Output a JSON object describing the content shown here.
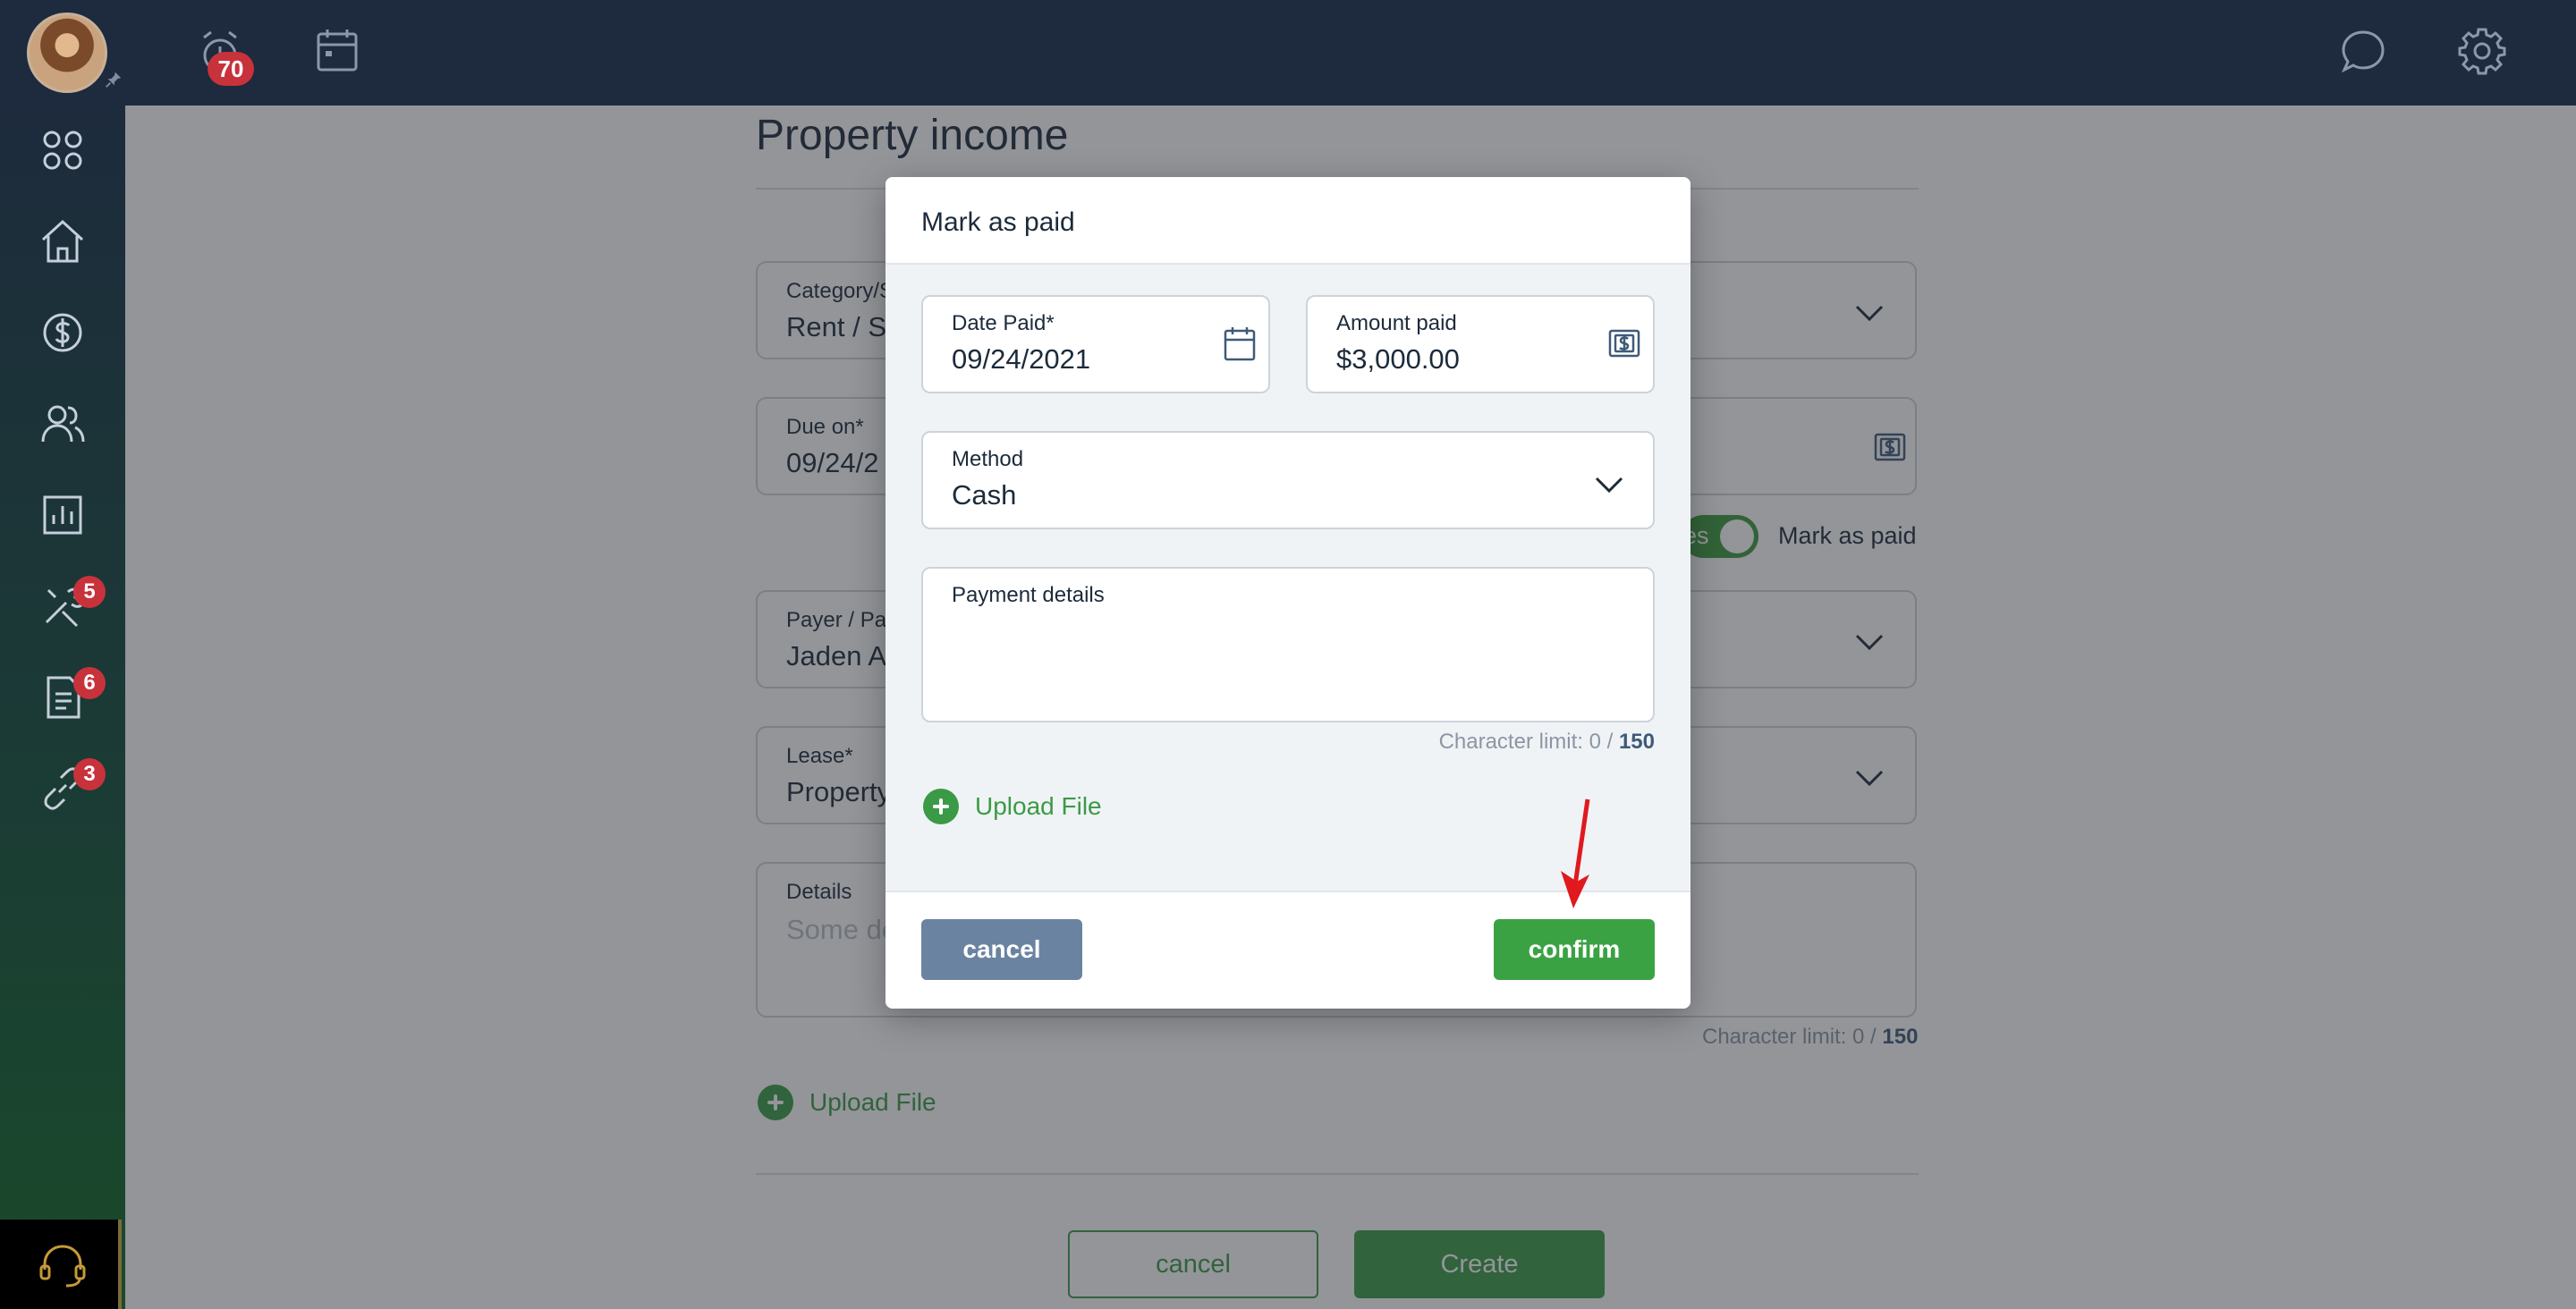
{
  "topbar": {
    "notifications_count": "70",
    "icons": [
      "avatar",
      "pin-icon",
      "alarm-icon",
      "calendar-icon",
      "chat-icon",
      "gear-icon"
    ]
  },
  "sidebar": {
    "items": [
      {
        "name": "apps-icon"
      },
      {
        "name": "home-icon"
      },
      {
        "name": "dollar-icon"
      },
      {
        "name": "people-icon"
      },
      {
        "name": "reports-icon"
      },
      {
        "name": "tools-icon",
        "badge": "5"
      },
      {
        "name": "document-icon",
        "badge": "6"
      },
      {
        "name": "link-icon",
        "badge": "3"
      }
    ],
    "support_icon": "headset-icon"
  },
  "page": {
    "title": "Property income",
    "category": {
      "label": "Category/S",
      "value": "Rent / St"
    },
    "due_on": {
      "label": "Due on*",
      "value": "09/24/2"
    },
    "toggle_label": "es",
    "mark_as_paid_label": "Mark as paid",
    "payer": {
      "label": "Payer / Pay",
      "value": "Jaden A"
    },
    "lease": {
      "label": "Lease*",
      "value": "Property"
    },
    "details": {
      "label": "Details",
      "placeholder": "Some de"
    },
    "char_limit_text": "Character limit: 0 / ",
    "char_limit_max": "150",
    "upload_label": "Upload File",
    "cancel_label": "cancel",
    "create_label": "Create"
  },
  "modal": {
    "title": "Mark as paid",
    "date_paid": {
      "label": "Date Paid*",
      "value": "09/24/2021"
    },
    "amount_paid": {
      "label": "Amount paid",
      "value": "$3,000.00"
    },
    "method": {
      "label": "Method",
      "value": "Cash"
    },
    "payment_details": {
      "label": "Payment details"
    },
    "char_limit_text": "Character limit: 0 / ",
    "char_limit_max": "150",
    "upload_label": "Upload File",
    "cancel_label": "cancel",
    "confirm_label": "confirm"
  },
  "colors": {
    "topbar": "#1e2a3d",
    "accent_green": "#3ba243",
    "cancel_blue": "#6a83a1",
    "badge_red": "#c8323b",
    "annotation_arrow": "#e0191f"
  }
}
